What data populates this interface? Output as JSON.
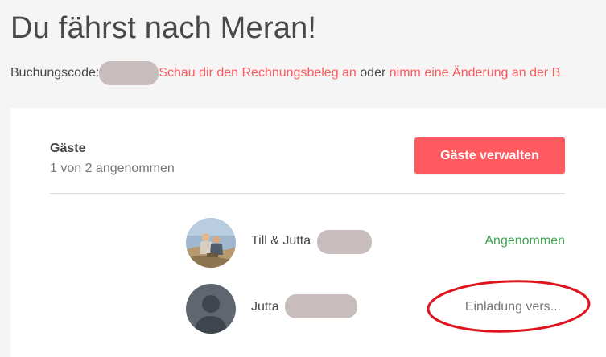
{
  "header": {
    "title": "Du fährst nach Meran!"
  },
  "booking": {
    "code_label": "Buchungscode:",
    "receipt_link": "Schau dir den Rechnungsbeleg an",
    "connector": "oder",
    "change_link": "nimm eine Änderung an der B"
  },
  "guests": {
    "title": "Gäste",
    "subtitle": "1 von 2 angenommen",
    "manage_label": "Gäste verwalten",
    "list": [
      {
        "name": "Till & Jutta",
        "status": "Angenommen",
        "avatar": "photo-avatar"
      },
      {
        "name": "Jutta",
        "status": "Einladung vers...",
        "avatar": "default-person-avatar"
      }
    ]
  },
  "colors": {
    "accent": "#ff5a5f",
    "accepted": "#3fa54f",
    "pending": "#767676",
    "annotation": "#e0141e",
    "redaction": "#c8bcbc"
  }
}
